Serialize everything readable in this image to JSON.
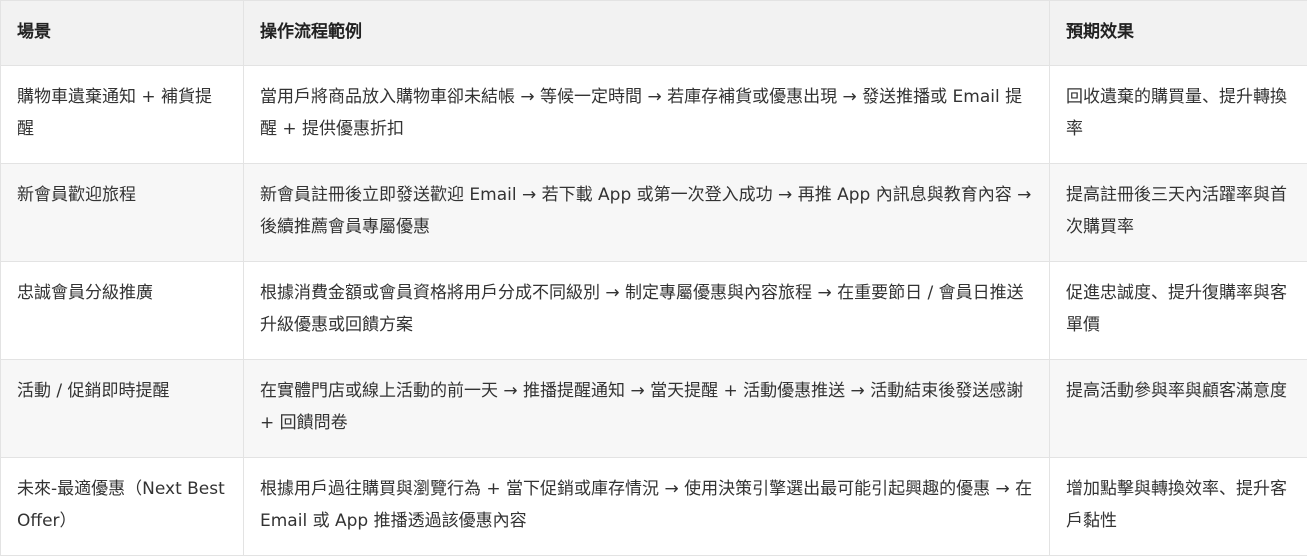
{
  "table": {
    "headers": [
      "場景",
      "操作流程範例",
      "預期效果"
    ],
    "rows": [
      {
        "scenario": "購物車遺棄通知 + 補貨提醒",
        "flow": "當用戶將商品放入購物車卻未結帳 → 等候一定時間 → 若庫存補貨或優惠出現 → 發送推播或 Email 提醒 + 提供優惠折扣",
        "effect": "回收遺棄的購買量、提升轉換率"
      },
      {
        "scenario": "新會員歡迎旅程",
        "flow": "新會員註冊後立即發送歡迎 Email → 若下載 App 或第一次登入成功 → 再推 App 內訊息與教育內容 → 後續推薦會員專屬優惠",
        "effect": "提高註冊後三天內活躍率與首次購買率"
      },
      {
        "scenario": "忠誠會員分級推廣",
        "flow": "根據消費金額或會員資格將用戶分成不同級別 → 制定專屬優惠與內容旅程 → 在重要節日 / 會員日推送升級優惠或回饋方案",
        "effect": "促進忠誠度、提升復購率與客單價"
      },
      {
        "scenario": "活動 / 促銷即時提醒",
        "flow": "在實體門店或線上活動的前一天 → 推播提醒通知 → 當天提醒 + 活動優惠推送 → 活動結束後發送感謝 + 回饋問卷",
        "effect": "提高活動參與率與顧客滿意度"
      },
      {
        "scenario": "未來-最適優惠（Next Best Offer）",
        "flow": "根據用戶過往購買與瀏覽行為 + 當下促銷或庫存情況 → 使用決策引擎選出最可能引起興趣的優惠 → 在 Email 或 App 推播透過該優惠內容",
        "effect": "增加點擊與轉換效率、提升客戶黏性"
      }
    ]
  }
}
